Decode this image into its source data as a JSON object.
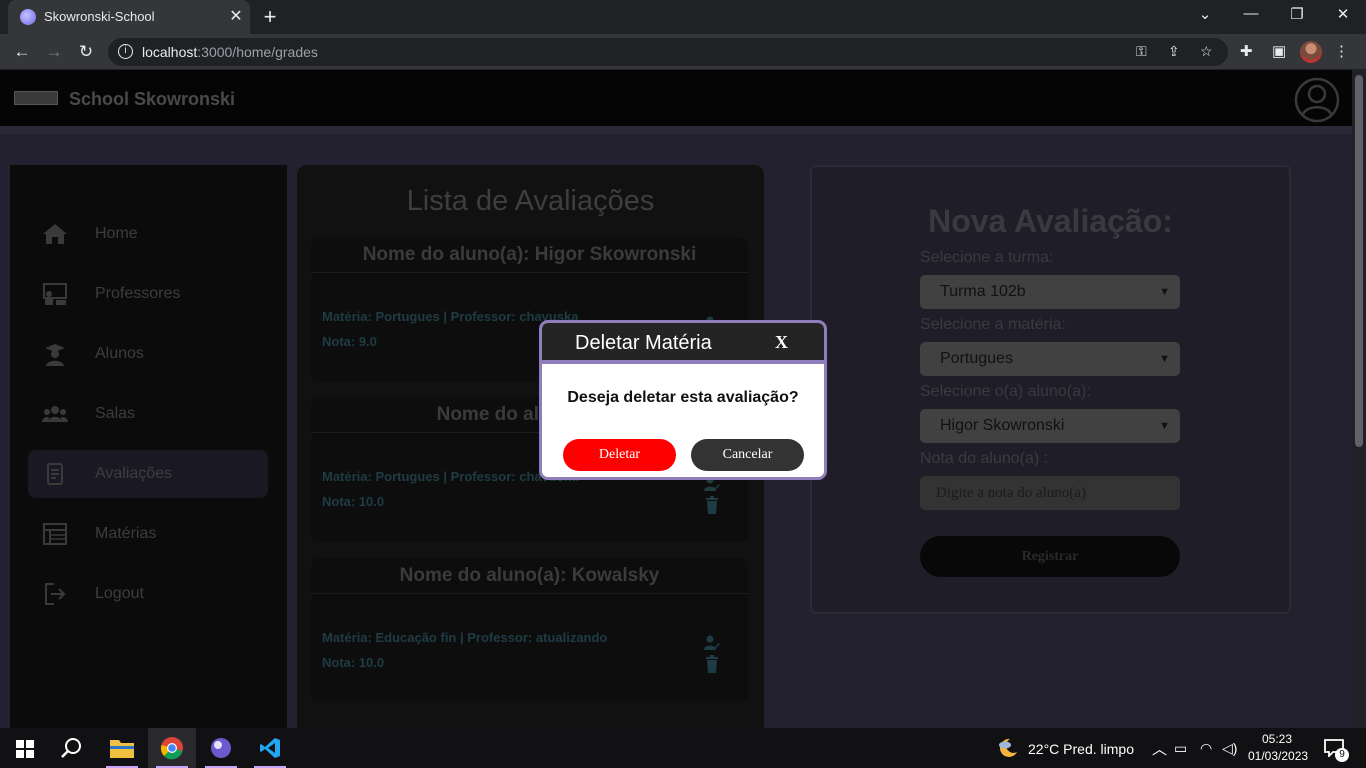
{
  "browser": {
    "tab_title": "Skowronski-School",
    "tab_close": "✕",
    "new_tab": "+",
    "url_host": "localhost",
    "url_path": ":3000/home/grades",
    "window_controls": [
      "⌄",
      "—",
      "❐",
      "✕"
    ]
  },
  "app": {
    "brand": "School Skowronski",
    "sidebar": {
      "items": [
        {
          "label": "Home",
          "icon": "home-icon"
        },
        {
          "label": "Professores",
          "icon": "teacher-icon"
        },
        {
          "label": "Alunos",
          "icon": "student-icon"
        },
        {
          "label": "Salas",
          "icon": "users-icon"
        },
        {
          "label": "Avaliações",
          "icon": "document-icon",
          "active": true
        },
        {
          "label": "Matérias",
          "icon": "table-icon"
        },
        {
          "label": "Logout",
          "icon": "logout-icon"
        }
      ]
    },
    "grades_list": {
      "title": "Lista de Avaliações",
      "cards": [
        {
          "student": "Nome do aluno(a): Higor Skowronski",
          "subject": "Matéria: Portugues | Professor: chavuska",
          "grade": "Nota: 9.0"
        },
        {
          "student": "Nome do aluno(a): H",
          "subject": "Matéria: Portugues | Professor: chavuska",
          "grade": "Nota: 10.0"
        },
        {
          "student": "Nome do aluno(a): Kowalsky",
          "subject": "Matéria: Educação fin | Professor: atualizando",
          "grade": "Nota: 10.0"
        }
      ]
    },
    "new_grade_form": {
      "title": "Nova Avaliação:",
      "class_label": "Selecione a turma:",
      "class_value": "Turma 102b",
      "subject_label": "Selecione a matéria:",
      "subject_value": "Portugues",
      "student_label": "Selecione o(a) aluno(a):",
      "student_value": "Higor Skowronski",
      "grade_label": "Nota do aluno(a) :",
      "grade_placeholder": "Digite a nota do aluno(a)",
      "submit_label": "Registrar"
    }
  },
  "modal": {
    "title": "Deletar Matéria",
    "close_label": "X",
    "message": "Deseja deletar esta avaliação?",
    "confirm_label": "Deletar",
    "cancel_label": "Cancelar"
  },
  "taskbar": {
    "weather": "22°C  Pred. limpo",
    "time": "05:23",
    "date": "01/03/2023",
    "notification_count": "9"
  }
}
